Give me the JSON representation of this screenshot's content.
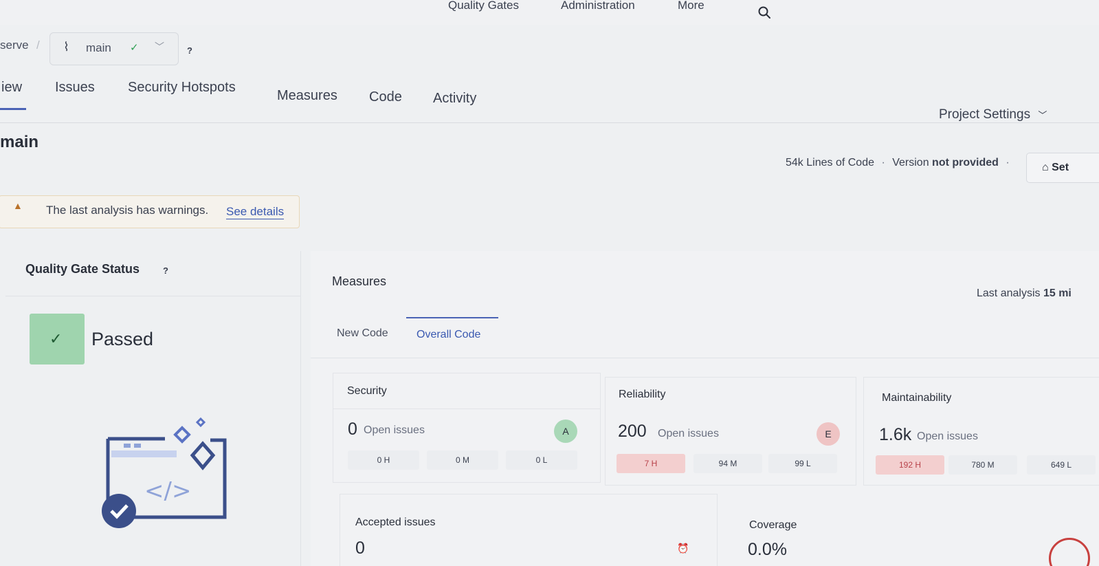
{
  "topnav": {
    "items": [
      "Quality Gates",
      "Administration",
      "More"
    ]
  },
  "breadcrumb": {
    "project": "serve",
    "separator": "/",
    "branch": "main",
    "help": "?"
  },
  "tabs": [
    "iew",
    "Issues",
    "Security Hotspots",
    "Measures",
    "Code",
    "Activity"
  ],
  "project_settings": "Project Settings",
  "header": {
    "branch_title": "main",
    "loc_value": "54k",
    "loc_label": "Lines of Code",
    "version_label": "Version",
    "version_value": "not provided",
    "set_button": "Set"
  },
  "warning": {
    "text": "The last analysis has warnings.",
    "link": "See details"
  },
  "quality_gate": {
    "title": "Quality Gate Status",
    "help": "?",
    "status": "Passed"
  },
  "measures": {
    "title": "Measures",
    "last_analysis_label": "Last analysis",
    "last_analysis_value": "15 mi",
    "tab_new": "New Code",
    "tab_overall": "Overall Code",
    "security": {
      "title": "Security",
      "count": "0",
      "label": "Open issues",
      "grade": "A",
      "high": "0 H",
      "medium": "0 M",
      "low": "0 L"
    },
    "reliability": {
      "title": "Reliability",
      "count": "200",
      "label": "Open issues",
      "grade": "E",
      "high": "7 H",
      "medium": "94 M",
      "low": "99 L"
    },
    "maintainability": {
      "title": "Maintainability",
      "count": "1.6k",
      "label": "Open issues",
      "high": "192 H",
      "medium": "780 M",
      "low": "649 L"
    },
    "accepted": {
      "title": "Accepted issues",
      "count": "0"
    },
    "coverage": {
      "title": "Coverage",
      "value": "0.0%"
    }
  },
  "colors": {
    "accent": "#4a63b5",
    "passed": "#9fd4ae",
    "grade_a": "#a9d8b7",
    "grade_e": "#efc4c4",
    "hot": "#f3cfcf"
  }
}
